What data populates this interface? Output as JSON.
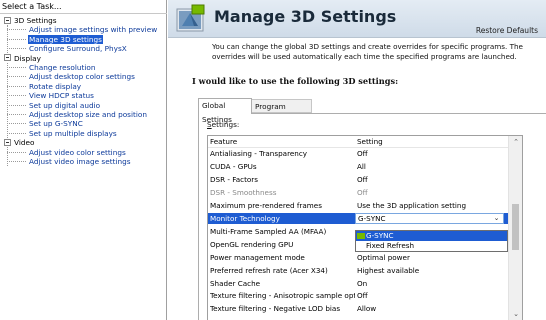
{
  "left_pane": {
    "header": "Select a Task...",
    "tree": [
      {
        "type": "category",
        "label": "3D Settings"
      },
      {
        "type": "item",
        "label": "Adjust image settings with preview"
      },
      {
        "type": "item",
        "label": "Manage 3D settings",
        "selected": true
      },
      {
        "type": "item",
        "label": "Configure Surround, PhysX"
      },
      {
        "type": "category",
        "label": "Display"
      },
      {
        "type": "item",
        "label": "Change resolution"
      },
      {
        "type": "item",
        "label": "Adjust desktop color settings"
      },
      {
        "type": "item",
        "label": "Rotate display"
      },
      {
        "type": "item",
        "label": "View HDCP status"
      },
      {
        "type": "item",
        "label": "Set up digital audio"
      },
      {
        "type": "item",
        "label": "Adjust desktop size and position"
      },
      {
        "type": "item",
        "label": "Set up G-SYNC"
      },
      {
        "type": "item",
        "label": "Set up multiple displays"
      },
      {
        "type": "category",
        "label": "Video"
      },
      {
        "type": "item",
        "label": "Adjust video color settings"
      },
      {
        "type": "item",
        "label": "Adjust video image settings"
      }
    ]
  },
  "main": {
    "title": "Manage 3D Settings",
    "restore_defaults": "Restore Defaults",
    "description": "You can change the global 3D settings and create overrides for specific programs. The overrides will be used automatically each time the specified programs are launched.",
    "section_heading": "I would like to use the following 3D settings:",
    "tabs": [
      {
        "label": "Global Settings",
        "active": true
      },
      {
        "label": "Program Settings",
        "active": false
      }
    ],
    "settings_label_prefix": "S",
    "settings_label_rest": "ettings:",
    "grid_header": {
      "feature": "Feature",
      "setting": "Setting"
    },
    "rows": [
      {
        "feature": "Antialiasing - Transparency",
        "setting": "Off"
      },
      {
        "feature": "CUDA - GPUs",
        "setting": "All"
      },
      {
        "feature": "DSR - Factors",
        "setting": "Off"
      },
      {
        "feature": "DSR - Smoothness",
        "setting": "Off",
        "disabled": true
      },
      {
        "feature": "Maximum pre-rendered frames",
        "setting": "Use the 3D application setting"
      },
      {
        "feature": "Monitor Technology",
        "setting": "G-SYNC",
        "selected": true
      },
      {
        "feature": "Multi-Frame Sampled AA (MFAA)",
        "setting": ""
      },
      {
        "feature": "OpenGL rendering GPU",
        "setting": ""
      },
      {
        "feature": "Power management mode",
        "setting": "Optimal power"
      },
      {
        "feature": "Preferred refresh rate (Acer X34)",
        "setting": "Highest available"
      },
      {
        "feature": "Shader Cache",
        "setting": "On"
      },
      {
        "feature": "Texture filtering - Anisotropic sample opti...",
        "setting": "Off"
      },
      {
        "feature": "Texture filtering - Negative LOD bias",
        "setting": "Allow"
      }
    ],
    "dropdown_options": [
      "G-SYNC",
      "Fixed Refresh"
    ],
    "dropdown_selected_index": 0
  },
  "colors": {
    "selection": "#1e5cd2",
    "link": "#0d3a9a",
    "nvidia_green": "#76b900"
  }
}
